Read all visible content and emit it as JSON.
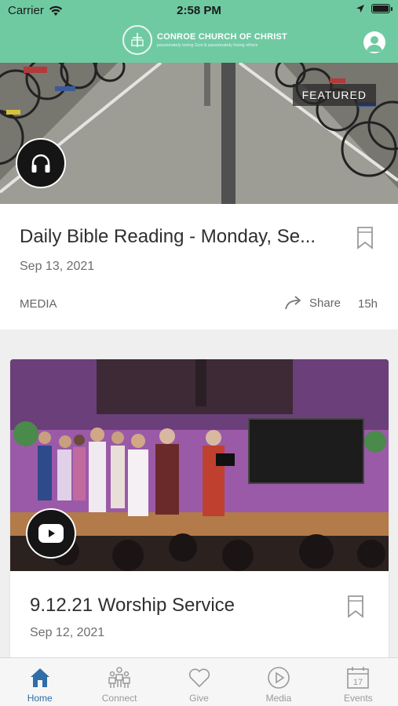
{
  "status_bar": {
    "carrier": "Carrier",
    "time": "2:58 PM"
  },
  "header": {
    "org_name": "CONROE CHURCH OF CHRIST",
    "tagline": "passionately loving God & passionately loving others"
  },
  "featured": {
    "badge": "FEATURED",
    "title": "Daily Bible Reading - Monday, Se...",
    "date": "Sep 13, 2021",
    "category": "MEDIA",
    "share_label": "Share",
    "age": "15h",
    "media_icon": "headphones-icon"
  },
  "second": {
    "title": "9.12.21 Worship Service",
    "date": "Sep 12, 2021",
    "media_icon": "youtube-icon"
  },
  "tabs": [
    {
      "label": "Home",
      "icon": "home-icon",
      "active": true
    },
    {
      "label": "Connect",
      "icon": "people-icon",
      "active": false
    },
    {
      "label": "Give",
      "icon": "heart-icon",
      "active": false
    },
    {
      "label": "Media",
      "icon": "play-circle-icon",
      "active": false
    },
    {
      "label": "Events",
      "icon": "calendar-icon",
      "active": false
    }
  ],
  "calendar_day": "17",
  "colors": {
    "header": "#6fcaa2",
    "active_tab": "#2f6ea6"
  }
}
